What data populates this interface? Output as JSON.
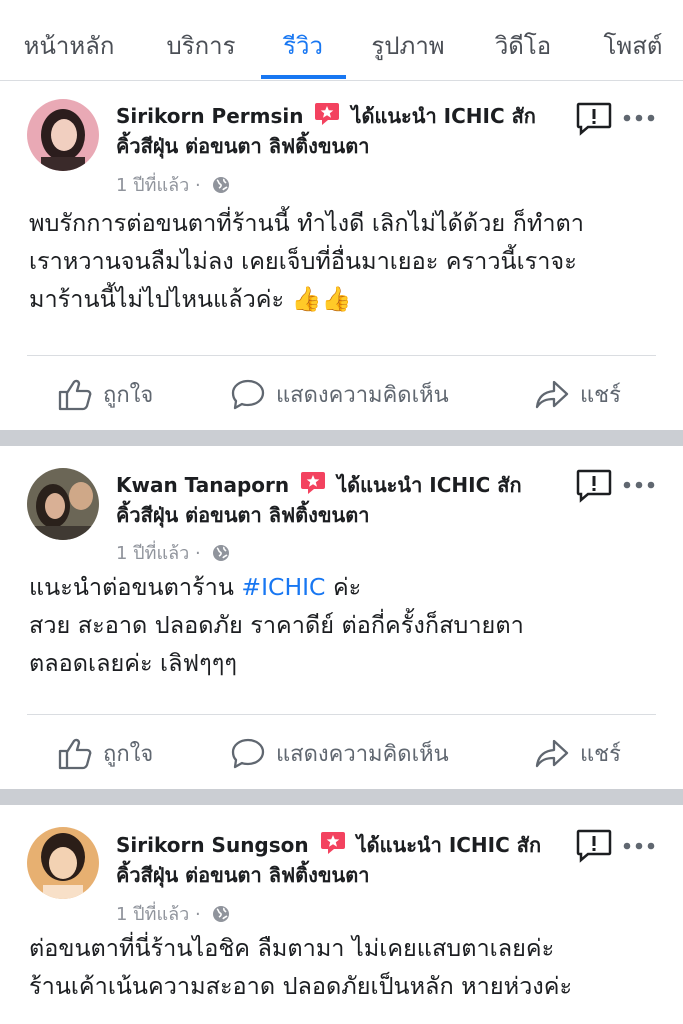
{
  "tabs": [
    {
      "label": "หน้าหลัก"
    },
    {
      "label": "บริการ"
    },
    {
      "label": "รีวิว"
    },
    {
      "label": "รูปภาพ"
    },
    {
      "label": "วิดีโอ"
    },
    {
      "label": "โพสต์"
    }
  ],
  "active_tab": "รีวิว",
  "accent_color": "#1877f2",
  "recommend_color": "#f3425f",
  "posts": [
    {
      "author": "Sirikorn Permsin",
      "recommend_text": "ได้แนะนำ",
      "page_name": "ICHIC สัก",
      "page_name_cont": "คิ้วสีฝุ่น ต่อขนตา ลิฟติ้งขนตา",
      "time": "1 ปีที่แล้ว",
      "dot": "·",
      "lines": [
        "พบรักการต่อขนตาที่ร้านนี้ ทำไงดี เลิกไม่ได้ด้วย ก็ทำตา",
        "เราหวานจนลืมไม่ลง เคยเจ็บที่อื่นมาเยอะ คราวนี้เราจะ",
        "มาร้านนี้ไม่ไปไหนแล้วค่ะ"
      ],
      "emoji": "👍👍"
    },
    {
      "author": "Kwan Tanaporn",
      "recommend_text": "ได้แนะนำ",
      "page_name": "ICHIC สัก",
      "page_name_cont": "คิ้วสีฝุ่น ต่อขนตา ลิฟติ้งขนตา",
      "time": "1 ปีที่แล้ว",
      "dot": "·",
      "line1_prefix": "แนะนำต่อขนตาร้าน",
      "hashtag": "#ICHIC",
      "line1_suffix": "ค่ะ",
      "lines": [
        "สวย สะอาด ปลอดภัย ราคาดีย์ ต่อกี่ครั้งก็สบายตา",
        "ตลอดเลยค่ะ เลิฟๆๆๆ"
      ]
    },
    {
      "author": "Sirikorn Sungson",
      "recommend_text": "ได้แนะนำ",
      "page_name": "ICHIC สัก",
      "page_name_cont": "คิ้วสีฝุ่น ต่อขนตา ลิฟติ้งขนตา",
      "time": "1 ปีที่แล้ว",
      "dot": "·",
      "lines": [
        "ต่อขนตาที่นี่ร้านไอชิค ลืมตามา ไม่เคยแสบตาเลยค่ะ",
        "ร้านเค้าเน้นความสะอาด ปลอดภัยเป็นหลัก หายห่วงค่ะ"
      ]
    }
  ],
  "actions": {
    "like": "ถูกใจ",
    "comment": "แสดงความคิดเห็น",
    "share": "แชร์"
  },
  "icons": {
    "recommend": "recommend-star-icon",
    "globe": "globe-icon",
    "report": "report-icon",
    "more": "more-icon",
    "like": "like-icon",
    "comment": "comment-icon",
    "share": "share-icon"
  }
}
